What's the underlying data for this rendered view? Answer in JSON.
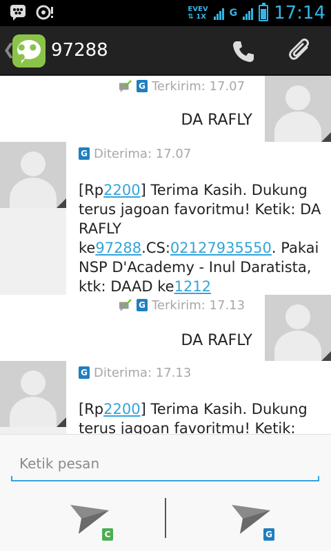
{
  "statusbar": {
    "net_top": "EVEV",
    "net_bottom": "1X",
    "net_g": "G",
    "battery_level": 0.85,
    "clock": "17:14"
  },
  "header": {
    "title": "97288",
    "icons": [
      "back-chevron-icon",
      "messaging-app-icon",
      "phone-icon",
      "attachment-icon"
    ]
  },
  "messages": [
    {
      "type": "sent",
      "status": "Terkirim: 17.07",
      "text": "DA RAFLY"
    },
    {
      "type": "received",
      "status": "Diterima: 17.07",
      "parts": {
        "p1": "[Rp",
        "l1": "2200",
        "p2": "] Terima Kasih. Dukung terus jagoan favoritmu! Ketik: DA RAFLY ke",
        "l2": "97288",
        "p3": ".CS:",
        "l3": "02127935550",
        "p4": ". Pakai NSP D'Academy - Inul Daratista, ktk: DAAD  ke",
        "l4": "1212"
      }
    },
    {
      "type": "sent",
      "status": "Terkirim: 17.13",
      "text": "DA RAFLY"
    },
    {
      "type": "received",
      "status": "Diterima: 17.13",
      "parts": {
        "p1": "[Rp",
        "l1": "2200",
        "p2": "] Terima Kasih. Dukung terus jagoan favoritmu! Ketik:"
      }
    }
  ],
  "badges": {
    "g": "G",
    "c": "C"
  },
  "compose": {
    "placeholder": "Ketik pesan",
    "send_c_badge": "C",
    "send_g_badge": "G",
    "c_color": "#4caf50",
    "g_color": "#1e7fc0"
  }
}
